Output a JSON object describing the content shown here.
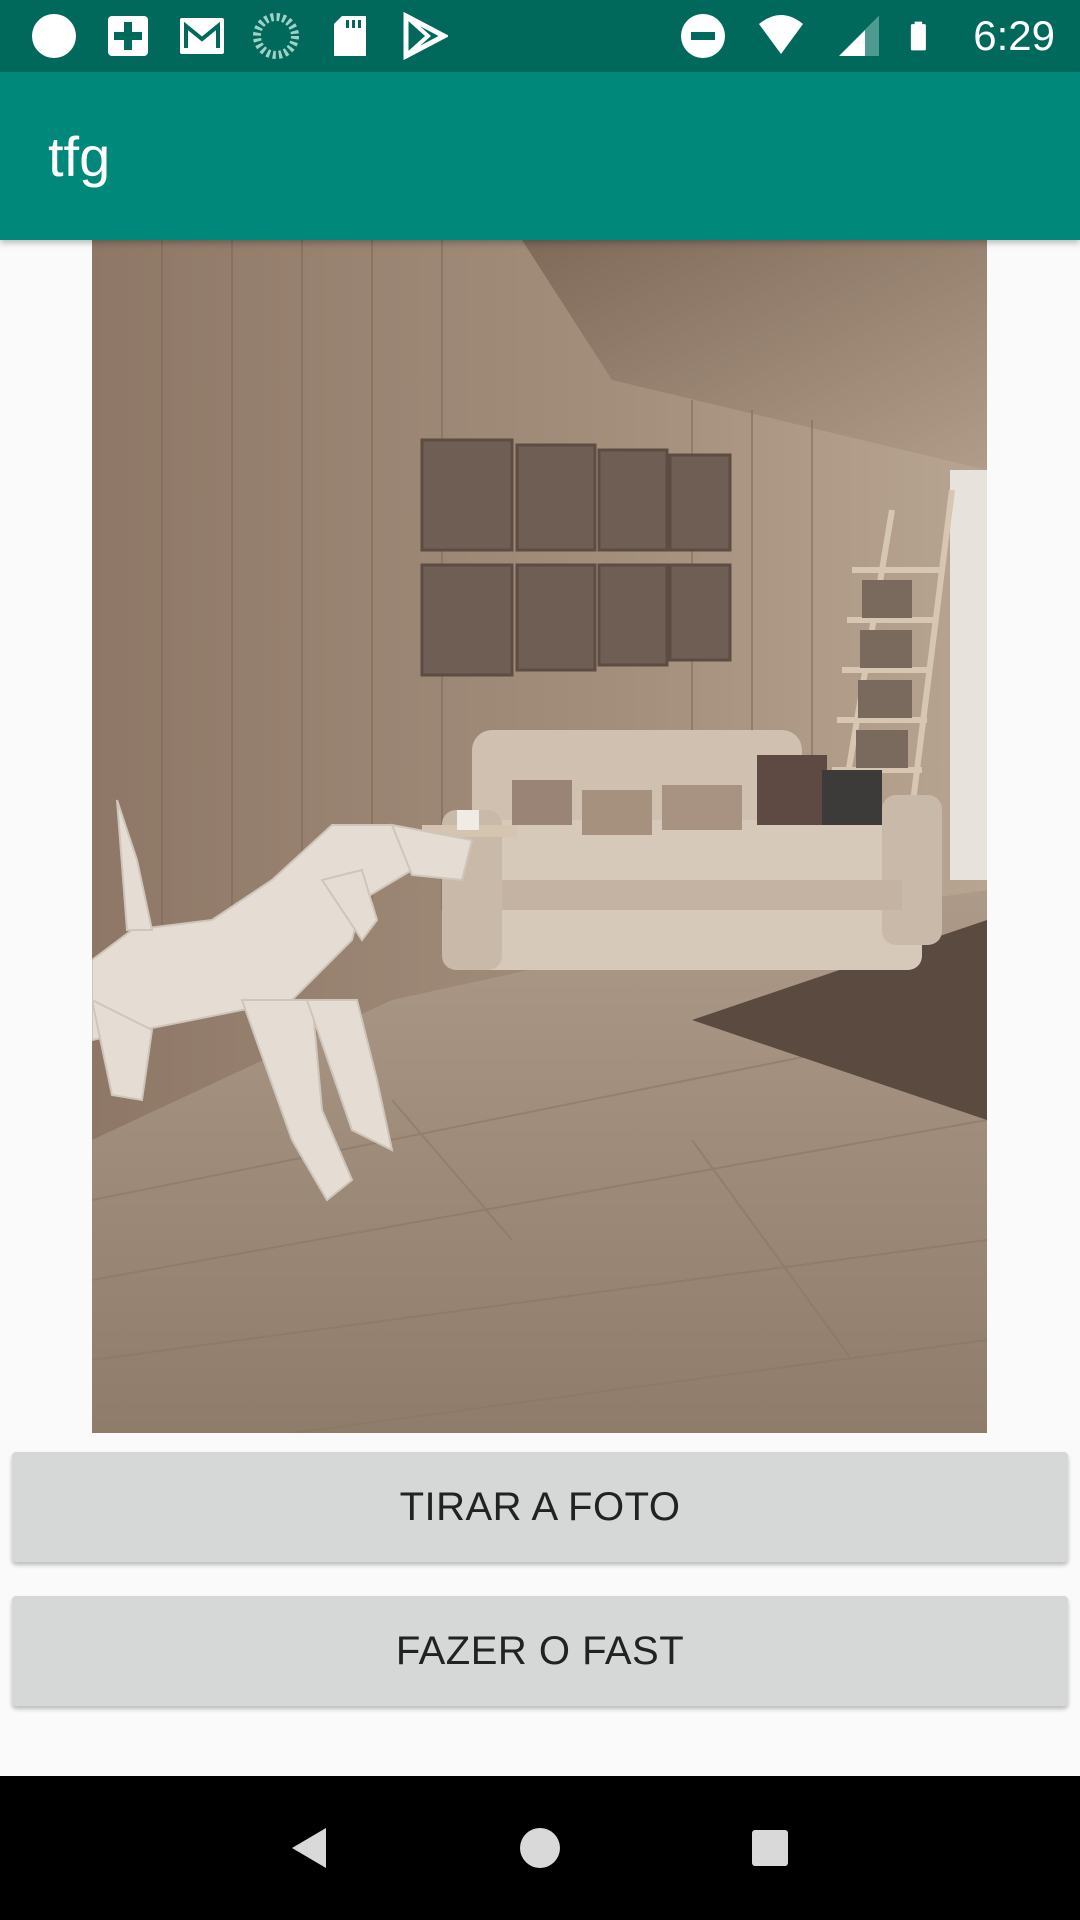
{
  "status_bar": {
    "time": "6:29",
    "left_icons": [
      "circle-icon",
      "hospital-cross-icon",
      "gmail-icon",
      "sync-progress-icon",
      "sd-card-icon",
      "play-store-icon"
    ],
    "right_icons": [
      "do-not-disturb-icon",
      "wifi-icon",
      "cell-signal-icon",
      "battery-icon"
    ]
  },
  "app_bar": {
    "title": "tfg"
  },
  "photo": {
    "description_icon": "room-with-dog-photo"
  },
  "buttons": {
    "take_photo": "TIRAR A FOTO",
    "do_fast": "FAZER O FAST"
  },
  "nav_bar": {
    "icons": [
      "back-icon",
      "home-icon",
      "recents-icon"
    ]
  },
  "colors": {
    "status_bar": "#00695c",
    "app_bar": "#00897b",
    "button": "#d6d7d7",
    "background": "#fafafa"
  }
}
